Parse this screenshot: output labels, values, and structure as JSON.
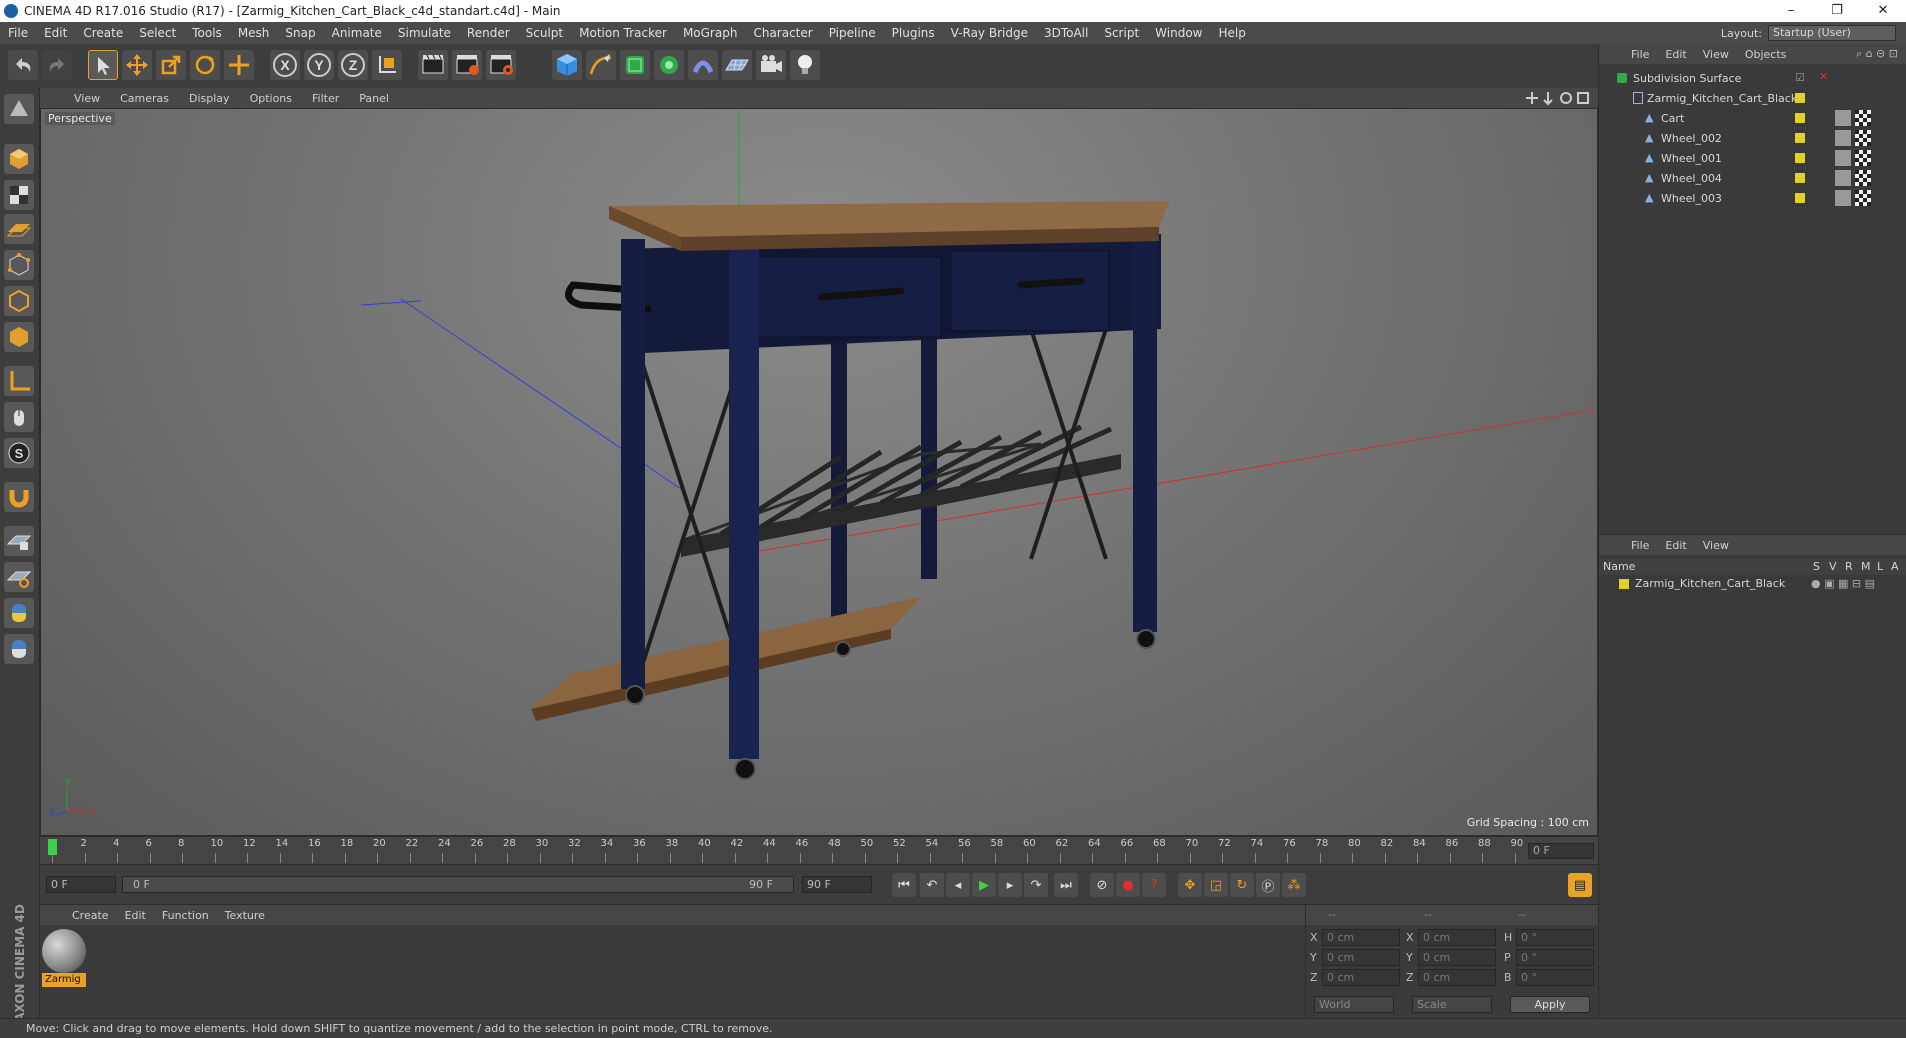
{
  "window": {
    "title": "CINEMA 4D R17.016 Studio (R17) - [Zarmig_Kitchen_Cart_Black_c4d_standart.c4d] - Main",
    "minimize": "–",
    "restore": "❐",
    "close": "✕"
  },
  "menu": [
    "File",
    "Edit",
    "Create",
    "Select",
    "Tools",
    "Mesh",
    "Snap",
    "Animate",
    "Simulate",
    "Render",
    "Sculpt",
    "Motion Tracker",
    "MoGraph",
    "Character",
    "Pipeline",
    "Plugins",
    "V-Ray Bridge",
    "3DToAll",
    "Script",
    "Window",
    "Help"
  ],
  "layout": {
    "label": "Layout:",
    "value": "Startup (User)"
  },
  "toolbar_axes": [
    "X",
    "Y",
    "Z"
  ],
  "viewport": {
    "menu": [
      "View",
      "Cameras",
      "Display",
      "Options",
      "Filter",
      "Panel"
    ],
    "label": "Perspective",
    "grid_spacing": "Grid Spacing : 100 cm",
    "axis_x": "X",
    "axis_y": "Y",
    "axis_z": "Z"
  },
  "timeline": {
    "ticks": [
      "0",
      "2",
      "4",
      "6",
      "8",
      "10",
      "12",
      "14",
      "16",
      "18",
      "20",
      "22",
      "24",
      "26",
      "28",
      "30",
      "32",
      "34",
      "36",
      "38",
      "40",
      "42",
      "44",
      "46",
      "48",
      "50",
      "52",
      "54",
      "56",
      "58",
      "60",
      "62",
      "64",
      "66",
      "68",
      "70",
      "72",
      "74",
      "76",
      "78",
      "80",
      "82",
      "84",
      "86",
      "88",
      "90"
    ],
    "current_frame": "0 F"
  },
  "playbar": {
    "start": "0 F",
    "range_start": "0 F",
    "range_end": "90 F",
    "end": "90 F"
  },
  "material_panel": {
    "menu": [
      "Create",
      "Edit",
      "Function",
      "Texture"
    ],
    "material_name": "Zarmig"
  },
  "coords": {
    "headers": [
      "--",
      "--",
      "--"
    ],
    "rows": [
      {
        "a": "X",
        "av": "0 cm",
        "b": "X",
        "bv": "0 cm",
        "c": "H",
        "cv": "0 °"
      },
      {
        "a": "Y",
        "av": "0 cm",
        "b": "Y",
        "bv": "0 cm",
        "c": "P",
        "cv": "0 °"
      },
      {
        "a": "Z",
        "av": "0 cm",
        "b": "Z",
        "bv": "0 cm",
        "c": "B",
        "cv": "0 °"
      }
    ],
    "mode1": "World",
    "mode2": "Scale",
    "apply": "Apply"
  },
  "objects_panel": {
    "menu": [
      "File",
      "Edit",
      "View",
      "Objects"
    ],
    "items": [
      {
        "name": "Subdivision Surface",
        "level": 0
      },
      {
        "name": "Zarmig_Kitchen_Cart_Black",
        "level": 1
      },
      {
        "name": "Cart",
        "level": 2
      },
      {
        "name": "Wheel_002",
        "level": 2
      },
      {
        "name": "Wheel_001",
        "level": 2
      },
      {
        "name": "Wheel_004",
        "level": 2
      },
      {
        "name": "Wheel_003",
        "level": 2
      }
    ]
  },
  "layers_panel": {
    "menu": [
      "File",
      "Edit",
      "View"
    ],
    "header_name": "Name",
    "header_cols": [
      "S",
      "V",
      "R",
      "M",
      "L",
      "A"
    ],
    "row": "Zarmig_Kitchen_Cart_Black"
  },
  "branding": "MAXON CINEMA 4D",
  "status": "Move: Click and drag to move elements. Hold down SHIFT to quantize movement / add to the selection in point mode, CTRL to remove.",
  "colors": {
    "accent_orange": "#e9a12a",
    "tag_yellow": "#e2d12b",
    "play_green": "#3fcf4a"
  }
}
